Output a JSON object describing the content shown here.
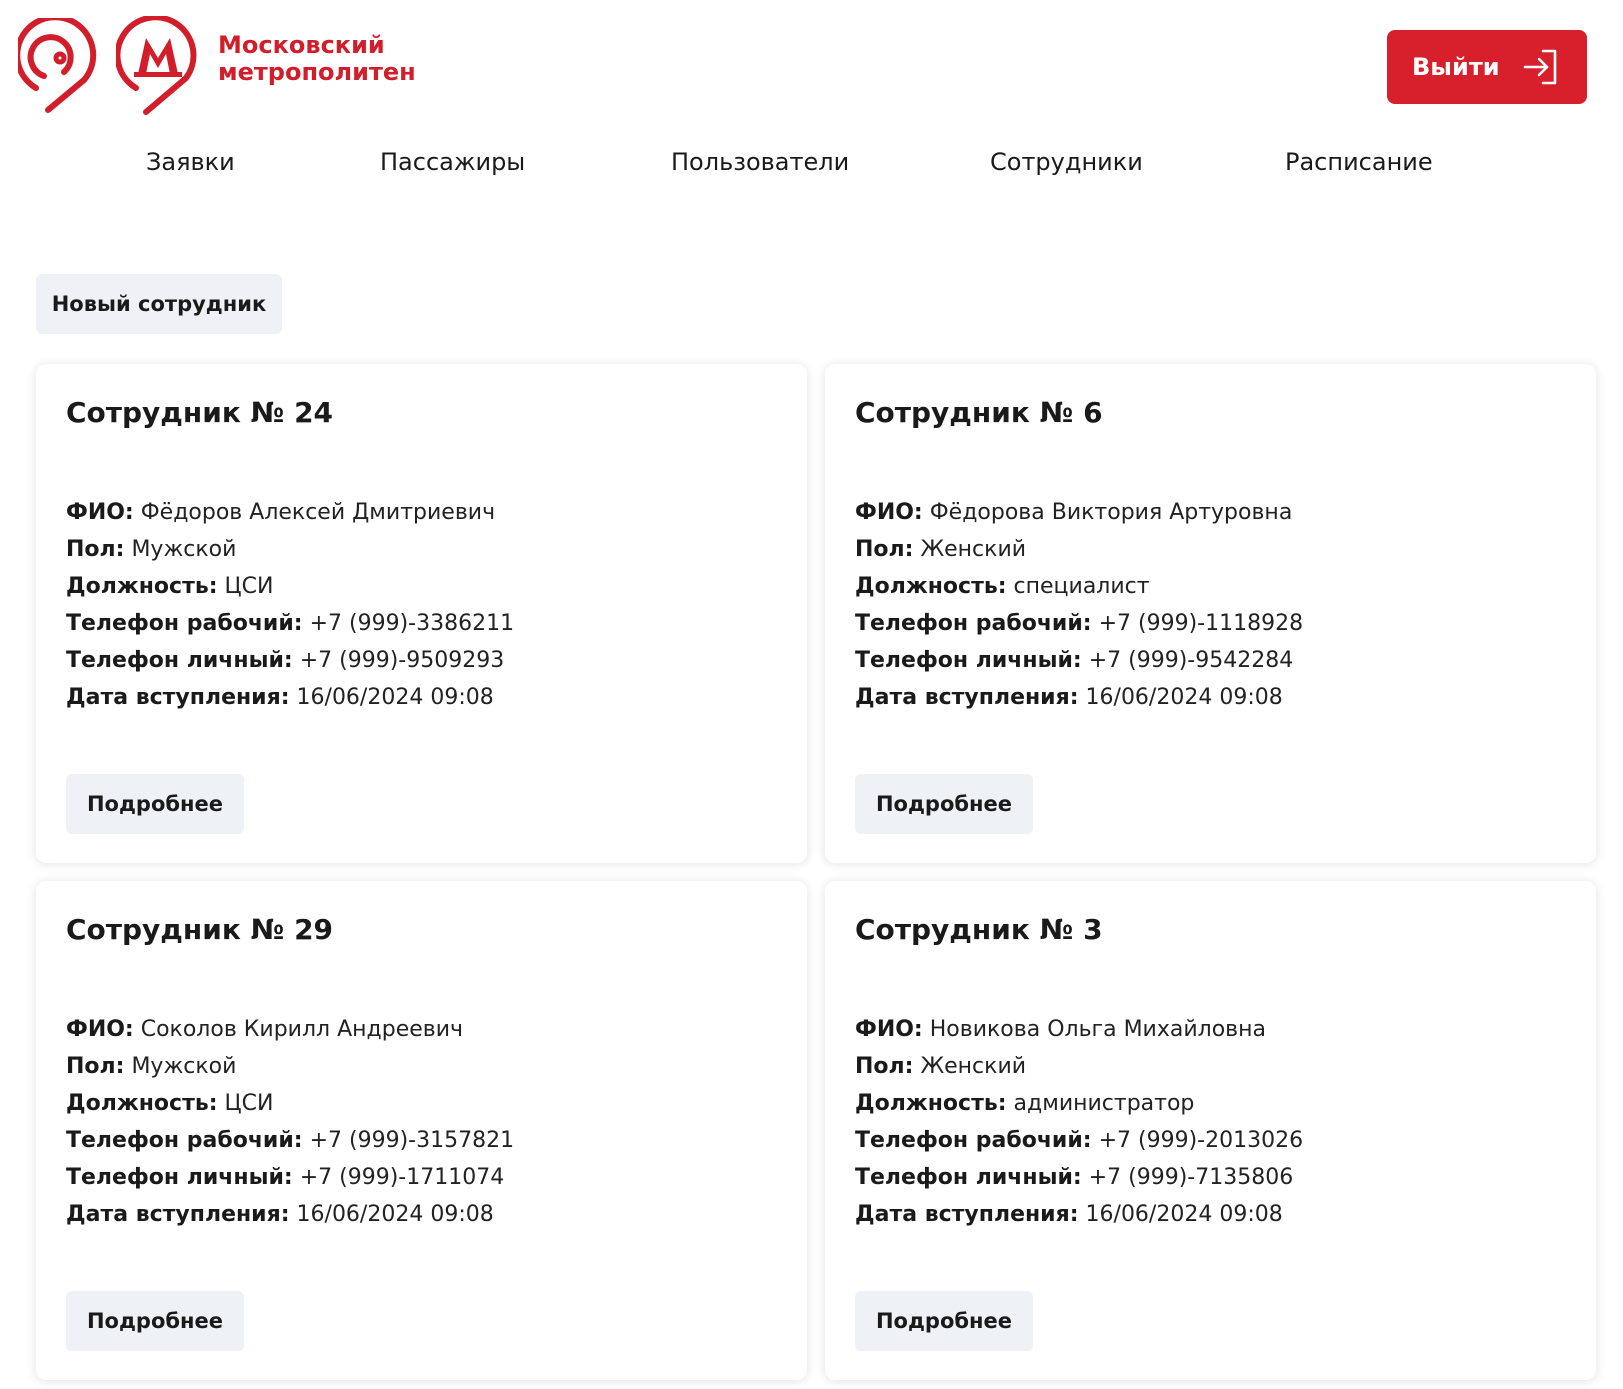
{
  "brand": {
    "line1": "Московский",
    "line2": "метрополитен",
    "color": "#d21e2b"
  },
  "header": {
    "logout_label": "Выйти",
    "logout_icon": "logout-arrow-icon",
    "accent": "#d7202b"
  },
  "nav": {
    "items": [
      {
        "label": "Заявки"
      },
      {
        "label": "Пассажиры"
      },
      {
        "label": "Пользователи"
      },
      {
        "label": "Сотрудники"
      },
      {
        "label": "Расписание"
      }
    ]
  },
  "toolbar": {
    "new_employee_label": "Новый сотрудник"
  },
  "labels": {
    "fio": "ФИО:",
    "gender": "Пол:",
    "position": "Должность:",
    "phone_work": "Телефон рабочий:",
    "phone_personal": "Телефон личный:",
    "join_date": "Дата вступления:",
    "details": "Подробнее"
  },
  "employees": [
    {
      "title": "Сотрудник № 24",
      "fio": "Фёдоров Алексей Дмитриевич",
      "gender": "Мужской",
      "position": "ЦСИ",
      "phone_work": "+7 (999)-3386211",
      "phone_personal": "+7 (999)-9509293",
      "join_date": "16/06/2024 09:08"
    },
    {
      "title": "Сотрудник № 6",
      "fio": "Фёдорова Виктория Артуровна",
      "gender": "Женский",
      "position": "специалист",
      "phone_work": "+7 (999)-1118928",
      "phone_personal": "+7 (999)-9542284",
      "join_date": "16/06/2024 09:08"
    },
    {
      "title": "Сотрудник № 29",
      "fio": "Соколов Кирилл Андреевич",
      "gender": "Мужской",
      "position": "ЦСИ",
      "phone_work": "+7 (999)-3157821",
      "phone_personal": "+7 (999)-1711074",
      "join_date": "16/06/2024 09:08"
    },
    {
      "title": "Сотрудник № 3",
      "fio": "Новикова Ольга Михайловна",
      "gender": "Женский",
      "position": "администратор",
      "phone_work": "+7 (999)-2013026",
      "phone_personal": "+7 (999)-7135806",
      "join_date": "16/06/2024 09:08"
    }
  ]
}
